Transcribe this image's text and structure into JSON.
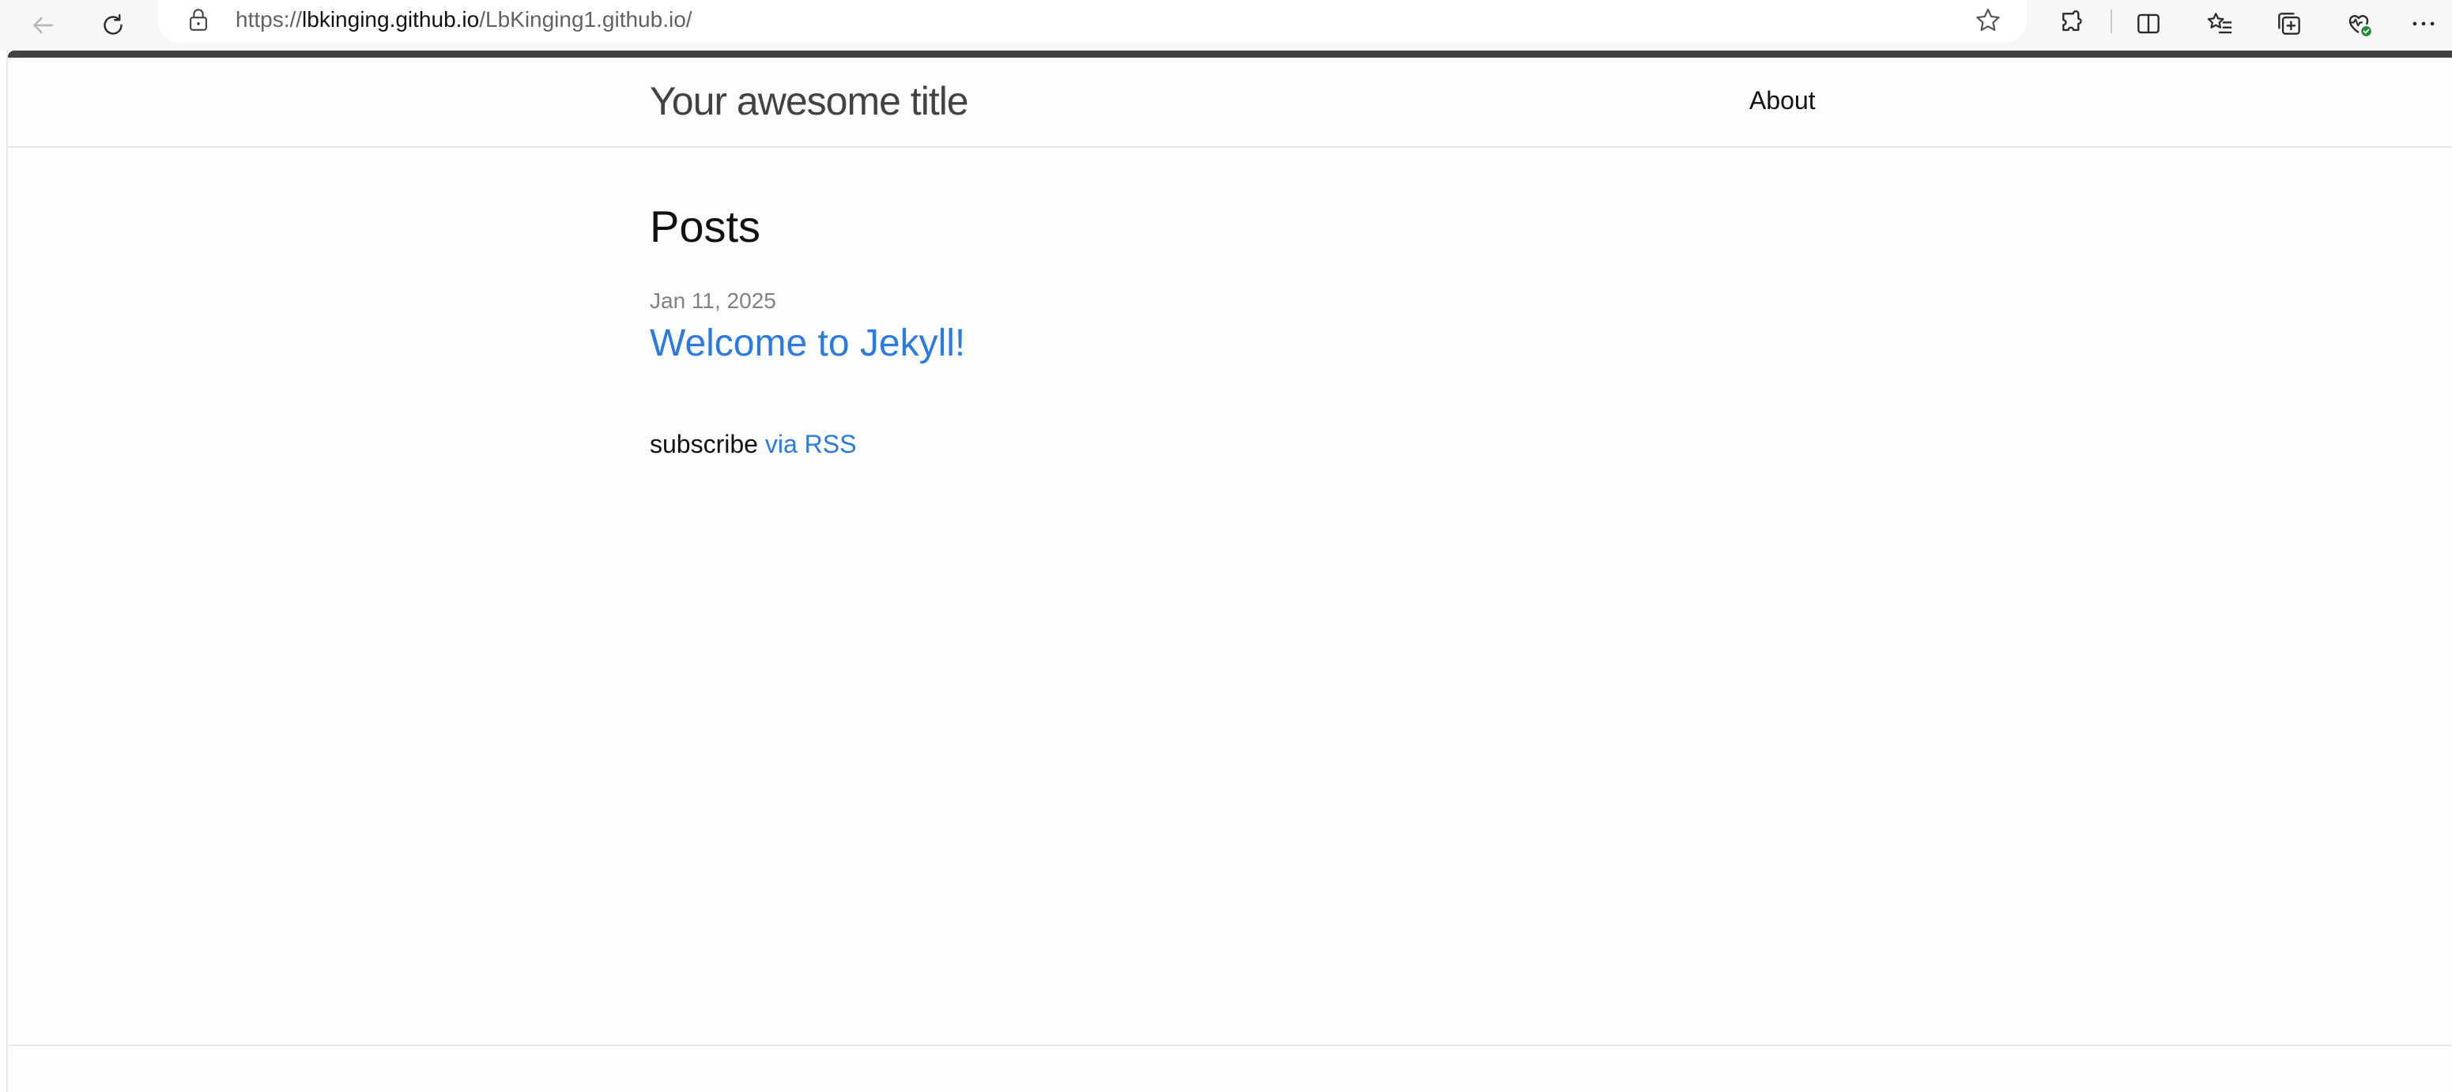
{
  "browser": {
    "url_scheme": "https://",
    "url_host": "lbkinging.github.io",
    "url_path": "/LbKinging1.github.io/"
  },
  "site": {
    "title": "Your awesome title",
    "nav": [
      {
        "label": "About"
      }
    ]
  },
  "main": {
    "heading": "Posts",
    "posts": [
      {
        "date": "Jan 11, 2025",
        "title": "Welcome to Jekyll!"
      }
    ],
    "subscribe_text": "subscribe",
    "rss_label": "via RSS"
  },
  "colors": {
    "link": "#2a7ae2",
    "title": "#424242",
    "meta": "#828282",
    "top_stripe": "#424242"
  },
  "icons": [
    "back-arrow-icon",
    "refresh-icon",
    "lock-icon",
    "favorite-star-icon",
    "extensions-icon",
    "split-screen-icon",
    "favorites-icon",
    "collections-icon",
    "browser-essentials-icon",
    "more-menu-icon"
  ]
}
